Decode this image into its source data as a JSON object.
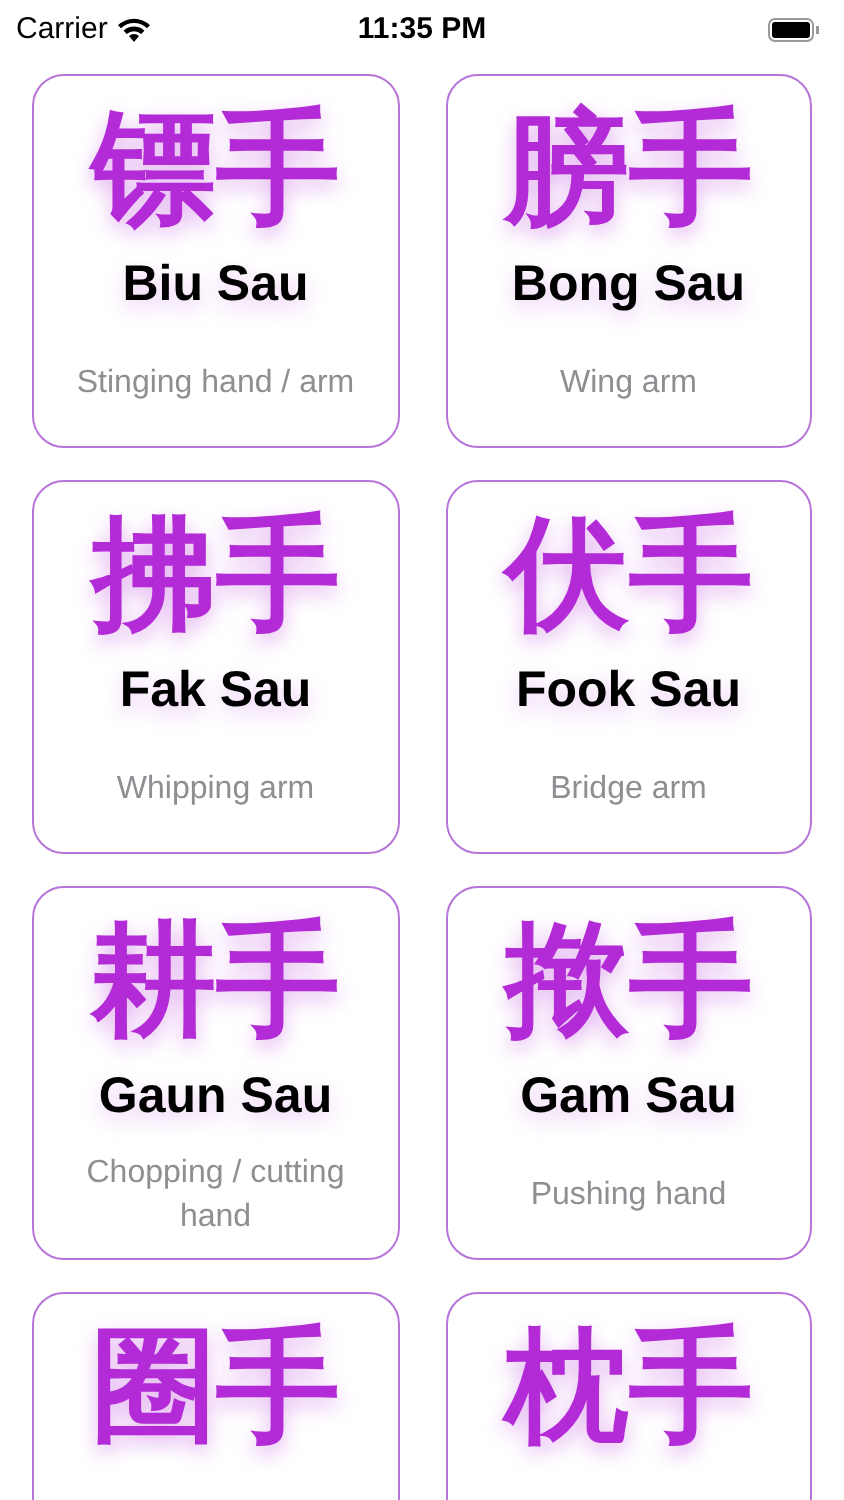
{
  "status_bar": {
    "carrier": "Carrier",
    "time": "11:35 PM"
  },
  "cards": [
    {
      "characters": "镖手",
      "name": "Biu Sau",
      "meaning": "Stinging hand / arm"
    },
    {
      "characters": "膀手",
      "name": "Bong Sau",
      "meaning": "Wing arm"
    },
    {
      "characters": "拂手",
      "name": "Fak Sau",
      "meaning": "Whipping arm"
    },
    {
      "characters": "伏手",
      "name": "Fook Sau",
      "meaning": "Bridge arm"
    },
    {
      "characters": "耕手",
      "name": "Gaun Sau",
      "meaning": "Chopping / cutting hand"
    },
    {
      "characters": "揿手",
      "name": "Gam Sau",
      "meaning": "Pushing hand"
    },
    {
      "characters": "圈手"
    },
    {
      "characters": "枕手"
    }
  ]
}
